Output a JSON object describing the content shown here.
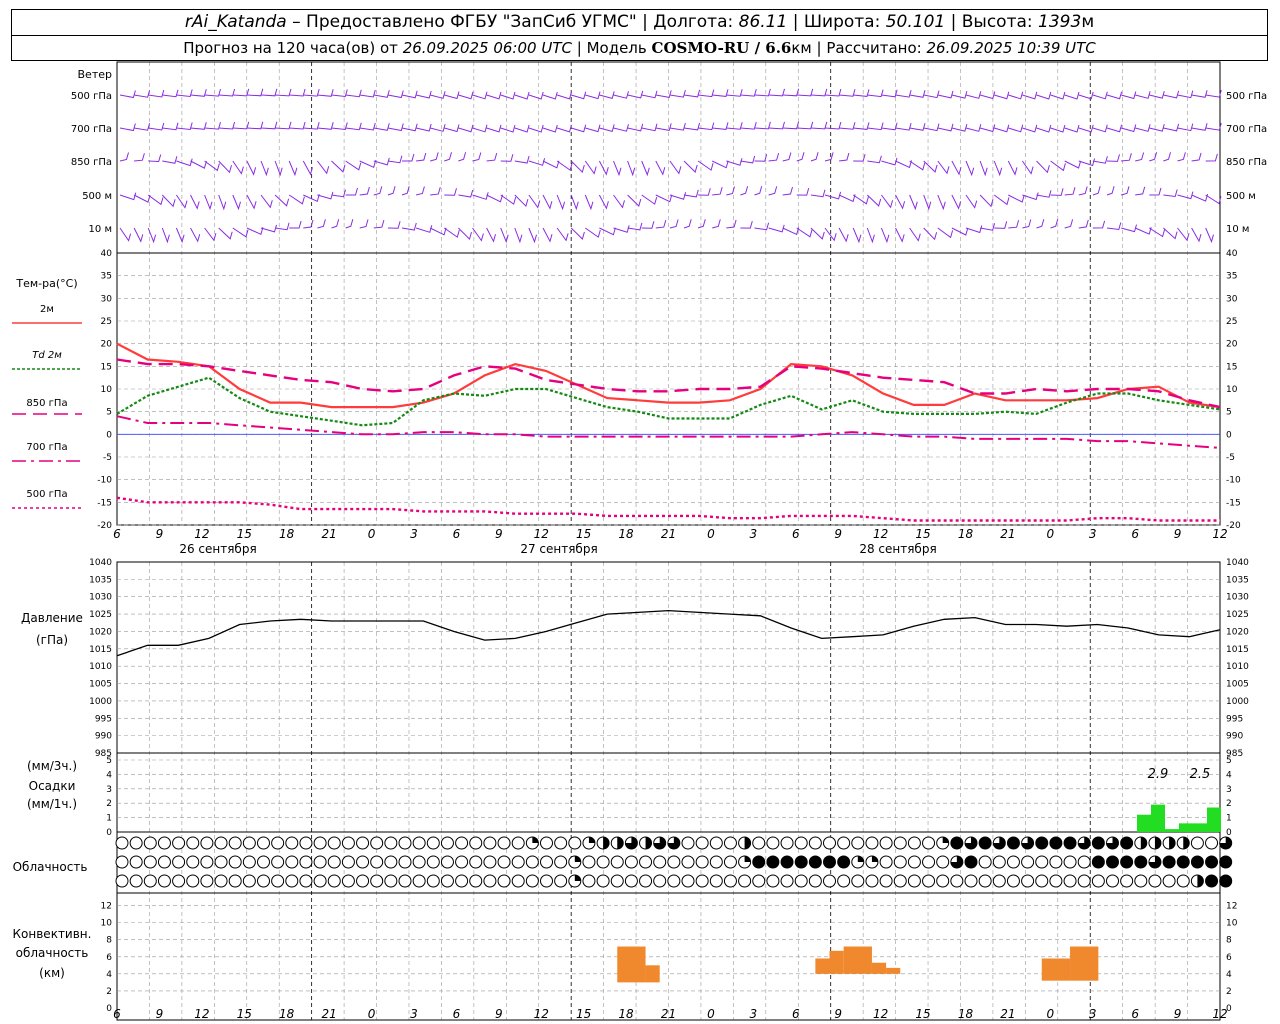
{
  "header": {
    "station": "rAi_Katanda",
    "provider": "Предоставлено ФГБУ \"ЗапСиб УГМС\"",
    "lon_label": "Долгота:",
    "lon": "86.11",
    "lat_label": "Широта:",
    "lat": "50.101",
    "alt_label": "Высота:",
    "alt": "1393",
    "alt_unit": "м",
    "forecast_prefix": "Прогноз на 120 часа(ов) от",
    "forecast_start": "26.09.2025 06:00 UTC",
    "model_label": "Модель",
    "model": "COSMO-RU / 6.6",
    "model_unit": "км",
    "calc_label": "Рассчитано:",
    "calc_time": "26.09.2025 10:39 UTC"
  },
  "colors": {
    "wind": "#8a2be2",
    "t2m": "#ff3b3b",
    "td2m": "#138a13",
    "t850": "#e6007e",
    "t700": "#e6007e",
    "t500": "#e6007e",
    "pressure": "#000000",
    "precip": "#22dd22",
    "convective": "#f0892e",
    "grid": "#9a9a9a"
  },
  "wind": {
    "title": "Ветер",
    "levels": [
      "500 гПа",
      "700 гПа",
      "850 гПа",
      "500 м",
      "10  м"
    ]
  },
  "hour_ticks": [
    "6",
    "9",
    "12",
    "15",
    "18",
    "21",
    "0",
    "3",
    "6",
    "9",
    "12",
    "15",
    "18",
    "21",
    "0",
    "3",
    "6",
    "9",
    "12",
    "15",
    "18",
    "21",
    "0",
    "3",
    "6",
    "9",
    "12"
  ],
  "day_labels": [
    "26 сентября",
    "27 сентября",
    "28 сентября"
  ],
  "chart_data": [
    {
      "type": "line",
      "title": "Тем-ра(°C)",
      "ylim": [
        -20,
        40
      ],
      "yticks": [
        -20,
        -15,
        -10,
        -5,
        0,
        5,
        10,
        15,
        20,
        25,
        30,
        35,
        40
      ],
      "x_hours": [
        0,
        3,
        6,
        9,
        12,
        15,
        18,
        21,
        24,
        27,
        30,
        33,
        36,
        39,
        42,
        45,
        48,
        51,
        54,
        57,
        60,
        63,
        66,
        69,
        72,
        75,
        78,
        81,
        84,
        87,
        90,
        93,
        96,
        99,
        102,
        105,
        108
      ],
      "series": [
        {
          "name": "2м",
          "values": [
            20,
            16.5,
            16,
            15,
            10,
            7,
            7,
            6,
            6,
            6,
            7,
            9,
            13,
            15.5,
            14,
            11,
            8,
            7.5,
            7,
            7,
            7.5,
            10,
            15.5,
            15,
            13,
            9,
            6.5,
            6.5,
            9,
            7.5,
            7.5,
            7.5,
            8,
            10,
            10.5,
            7,
            6
          ]
        },
        {
          "name": "Td  2м",
          "values": [
            4.5,
            8.5,
            10.5,
            12.5,
            8,
            5,
            4,
            3,
            2,
            2.5,
            7.5,
            9,
            8.5,
            10,
            10,
            8,
            6,
            5,
            3.5,
            3.5,
            3.5,
            6.5,
            8.5,
            5.5,
            7.5,
            5,
            4.5,
            4.5,
            4.5,
            5,
            4.5,
            7,
            9,
            9,
            7.5,
            6.5,
            5.5
          ]
        },
        {
          "name": "850 гПа",
          "values": [
            16.5,
            15.5,
            15.5,
            15,
            14,
            13,
            12,
            11.5,
            10,
            9.5,
            10,
            13,
            15,
            14.5,
            12,
            11,
            10,
            9.5,
            9.5,
            10,
            10,
            10.5,
            15,
            14.5,
            13.5,
            12.5,
            12,
            11.5,
            9,
            9,
            10,
            9.5,
            10,
            10,
            9.5,
            7.5,
            6
          ]
        },
        {
          "name": "700 гПа",
          "values": [
            4,
            2.5,
            2.5,
            2.5,
            2,
            1.5,
            1,
            0.5,
            0,
            0,
            0.5,
            0.5,
            0,
            0,
            -0.5,
            -0.5,
            -0.5,
            -0.5,
            -0.5,
            -0.5,
            -0.5,
            -0.5,
            -0.5,
            0,
            0.5,
            0,
            -0.5,
            -0.5,
            -1,
            -1,
            -1,
            -1,
            -1.5,
            -1.5,
            -2,
            -2.5,
            -3
          ]
        },
        {
          "name": "500 гПа",
          "values": [
            -14,
            -15,
            -15,
            -15,
            -15,
            -15.5,
            -16.5,
            -16.5,
            -16.5,
            -16.5,
            -17,
            -17,
            -17,
            -17.5,
            -17.5,
            -17.5,
            -18,
            -18,
            -18,
            -18,
            -18.5,
            -18.5,
            -18,
            -18,
            -18,
            -18.5,
            -19,
            -19,
            -19,
            -19,
            -19,
            -19,
            -18.5,
            -18.5,
            -19,
            -19,
            -19
          ]
        }
      ]
    },
    {
      "type": "line",
      "title": "Давление",
      "ylabel": "(гПа)",
      "ylim": [
        985,
        1040
      ],
      "yticks": [
        985,
        990,
        995,
        1000,
        1005,
        1010,
        1015,
        1020,
        1025,
        1030,
        1035,
        1040
      ],
      "x_hours": [
        0,
        3,
        6,
        9,
        12,
        15,
        18,
        21,
        24,
        27,
        30,
        33,
        36,
        39,
        42,
        45,
        48,
        51,
        54,
        57,
        60,
        63,
        66,
        69,
        72,
        75,
        78,
        81,
        84,
        87,
        90,
        93,
        96,
        99,
        102,
        105,
        108
      ],
      "series": [
        {
          "name": "",
          "values": [
            1013,
            1016,
            1016,
            1018,
            1022,
            1023,
            1023.5,
            1023,
            1023,
            1023,
            1023,
            1020,
            1017.5,
            1018,
            1020,
            1022.5,
            1025,
            1025.5,
            1026,
            1025.5,
            1025,
            1024.5,
            1021,
            1018,
            1018.5,
            1019,
            1021.5,
            1023.5,
            1024,
            1022,
            1022,
            1021.5,
            1022,
            1021,
            1019,
            1018.5,
            1020.5
          ]
        }
      ]
    },
    {
      "type": "bar",
      "title": "Осадки",
      "ylabel_top": "(мм/3ч.)",
      "ylabel_bottom": "(мм/1ч.)",
      "ylim": [
        0,
        5
      ],
      "yticks": [
        0,
        1,
        2,
        3,
        4,
        5
      ],
      "annotations": [
        "2.9",
        "2.5"
      ],
      "x_hours": [
        100,
        101,
        102,
        103,
        104,
        105,
        106
      ],
      "series": [
        {
          "name": "",
          "values": [
            1.2,
            1.9,
            0.2,
            0.6,
            0.6,
            1.7,
            0
          ]
        }
      ]
    },
    {
      "type": "table",
      "title": "Облачность",
      "rows": 3,
      "columns": 79,
      "value_meaning": "cloud fraction 0..1 per symbol; rows: top, middle, bottom",
      "row_top": [
        0,
        0,
        0,
        0,
        0,
        0,
        0,
        0,
        0,
        0,
        0,
        0,
        0,
        0,
        0,
        0,
        0,
        0,
        0,
        0,
        0,
        0,
        0,
        0,
        0,
        0,
        0,
        0,
        0,
        0.25,
        0,
        0,
        0,
        0.25,
        0.5,
        0.5,
        0.75,
        0.5,
        0.75,
        0.75,
        0,
        0,
        0,
        0,
        0.5,
        0,
        0,
        0,
        0,
        0,
        0,
        0,
        0,
        0,
        0,
        0,
        0,
        0,
        0.25,
        1,
        0.75,
        1,
        0.75,
        1,
        0.75,
        1,
        1,
        1,
        0.75,
        1,
        0.75,
        1,
        0.5,
        0.5,
        0.5,
        0.5,
        0,
        0,
        0.75
      ],
      "row_middle": [
        0,
        0,
        0,
        0,
        0,
        0,
        0,
        0,
        0,
        0,
        0,
        0,
        0,
        0,
        0,
        0,
        0,
        0,
        0,
        0,
        0,
        0,
        0,
        0,
        0,
        0,
        0,
        0,
        0,
        0,
        0,
        0,
        0.25,
        0,
        0,
        0,
        0,
        0,
        0,
        0,
        0,
        0,
        0,
        0,
        0.25,
        1,
        1,
        1,
        1,
        1,
        1,
        1,
        0.25,
        0.25,
        0,
        0,
        0,
        0,
        0,
        0.75,
        1,
        0,
        0,
        0,
        0,
        0,
        0,
        0,
        0,
        1,
        1,
        1,
        1,
        0.75,
        1,
        1,
        1,
        1,
        1
      ],
      "row_bottom": [
        0,
        0,
        0,
        0,
        0,
        0,
        0,
        0,
        0,
        0,
        0,
        0,
        0,
        0,
        0,
        0,
        0,
        0,
        0,
        0,
        0,
        0,
        0,
        0,
        0,
        0,
        0,
        0,
        0,
        0,
        0,
        0,
        0.25,
        0,
        0,
        0,
        0,
        0,
        0,
        0,
        0,
        0,
        0,
        0,
        0,
        0,
        0,
        0,
        0,
        0,
        0,
        0,
        0,
        0,
        0,
        0,
        0,
        0,
        0,
        0,
        0,
        0,
        0,
        0,
        0,
        0,
        0,
        0,
        0,
        0,
        0,
        0,
        0,
        0,
        0,
        0,
        0.5,
        1,
        1
      ]
    },
    {
      "type": "bar",
      "title": "Конвективн. облачность",
      "ylabel": "(км)",
      "ylim": [
        0,
        13
      ],
      "yticks": [
        0,
        2,
        4,
        6,
        8,
        10,
        12
      ],
      "bars": [
        {
          "x0": 35,
          "x1": 37,
          "base": 3,
          "top": 7.2
        },
        {
          "x0": 37,
          "x1": 38,
          "base": 3,
          "top": 5
        },
        {
          "x0": 49,
          "x1": 50,
          "base": 4,
          "top": 5.8
        },
        {
          "x0": 50,
          "x1": 51,
          "base": 4,
          "top": 6.7
        },
        {
          "x0": 51,
          "x1": 53,
          "base": 4,
          "top": 7.2
        },
        {
          "x0": 53,
          "x1": 54,
          "base": 4,
          "top": 5.3
        },
        {
          "x0": 54,
          "x1": 55,
          "base": 4,
          "top": 4.7
        },
        {
          "x0": 65,
          "x1": 67,
          "base": 3.2,
          "top": 5.8
        },
        {
          "x0": 67,
          "x1": 69,
          "base": 3.2,
          "top": 7.2
        },
        {
          "x0": 82,
          "x1": 85,
          "base": 4.2,
          "top": 5.8
        },
        {
          "x0": 85,
          "x1": 86,
          "base": 4.2,
          "top": 5.6
        },
        {
          "x0": 86,
          "x1": 87,
          "base": 4.2,
          "top": 7.7
        },
        {
          "x0": 87,
          "x1": 88,
          "base": 4.2,
          "top": 5.2
        },
        {
          "x0": 89,
          "x1": 90,
          "base": 4.5,
          "top": 5.3
        },
        {
          "x0": 90,
          "x1": 91,
          "base": 4,
          "top": 4.8
        },
        {
          "x0": 91,
          "x1": 92,
          "base": 4,
          "top": 5.5
        },
        {
          "x0": 92,
          "x1": 94,
          "base": 4,
          "top": 5.3
        },
        {
          "x0": 94,
          "x1": 95,
          "base": 4,
          "top": 4.8
        },
        {
          "x0": 95,
          "x1": 96,
          "base": 4,
          "top": 5.5
        },
        {
          "x0": 96,
          "x1": 98,
          "base": 1.8,
          "top": 9
        },
        {
          "x0": 98,
          "x1": 100,
          "base": 1.8,
          "top": 2
        },
        {
          "x0": 100,
          "x1": 102,
          "base": 1.8,
          "top": 1.9
        }
      ]
    }
  ]
}
